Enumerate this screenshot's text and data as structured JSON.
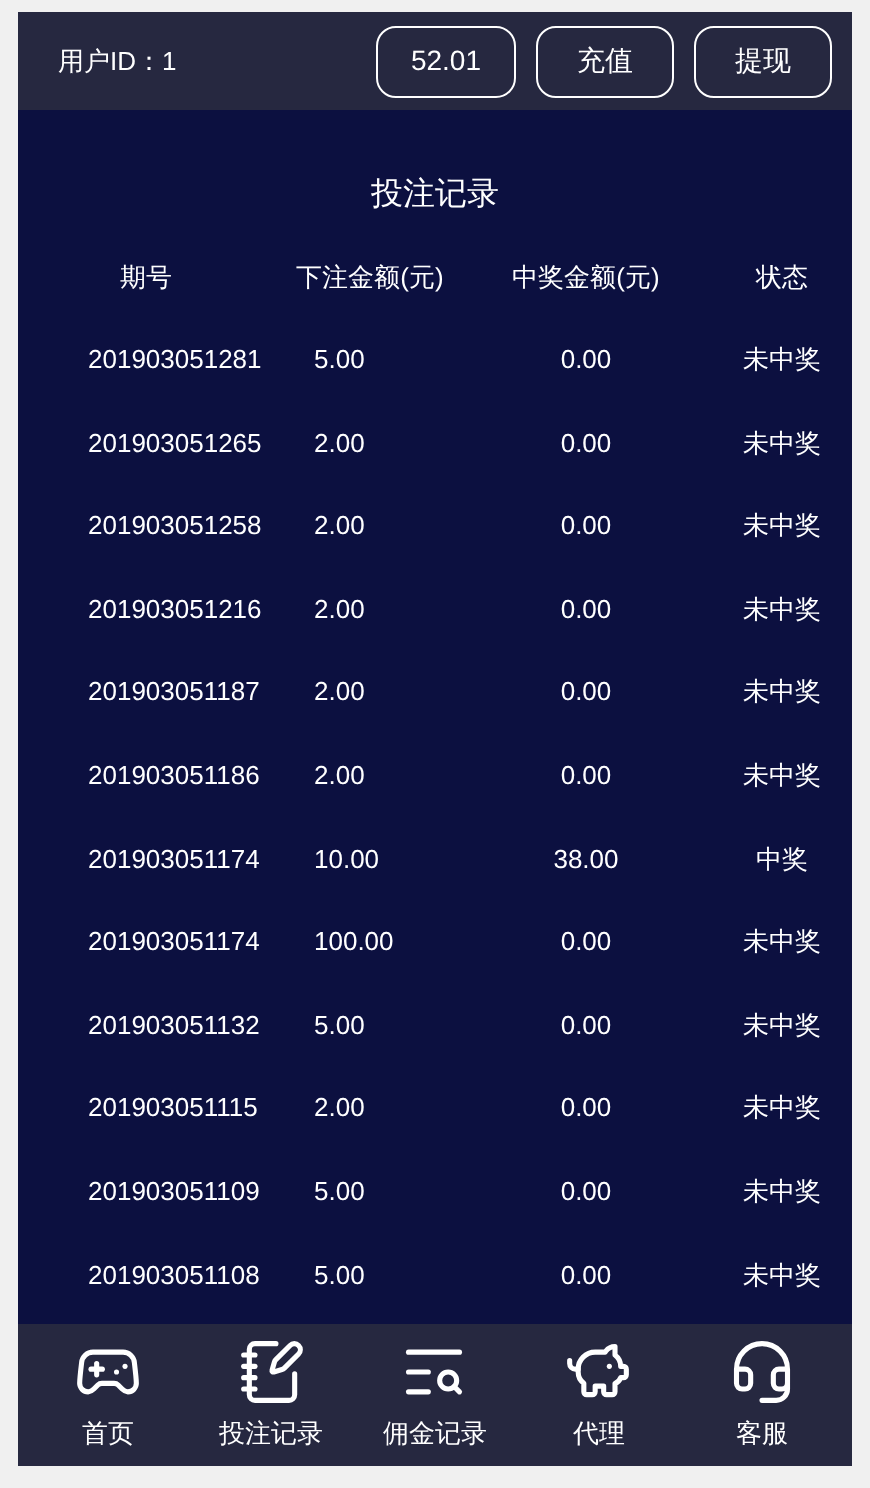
{
  "header": {
    "user_label": "用户ID：1",
    "balance": "52.01",
    "buttons": [
      "充值",
      "提现"
    ]
  },
  "title": "投注记录",
  "table": {
    "columns": [
      "期号",
      "下注金额(元)",
      "中奖金额(元)",
      "状态"
    ],
    "rows": [
      [
        "201903051281",
        "5.00",
        "0.00",
        "未中奖"
      ],
      [
        "201903051265",
        "2.00",
        "0.00",
        "未中奖"
      ],
      [
        "201903051258",
        "2.00",
        "0.00",
        "未中奖"
      ],
      [
        "201903051216",
        "2.00",
        "0.00",
        "未中奖"
      ],
      [
        "201903051187",
        "2.00",
        "0.00",
        "未中奖"
      ],
      [
        "201903051186",
        "2.00",
        "0.00",
        "未中奖"
      ],
      [
        "201903051174",
        "10.00",
        "38.00",
        "中奖"
      ],
      [
        "201903051174",
        "100.00",
        "0.00",
        "未中奖"
      ],
      [
        "201903051132",
        "5.00",
        "0.00",
        "未中奖"
      ],
      [
        "201903051115",
        "2.00",
        "0.00",
        "未中奖"
      ],
      [
        "201903051109",
        "5.00",
        "0.00",
        "未中奖"
      ],
      [
        "201903051108",
        "5.00",
        "0.00",
        "未中奖"
      ]
    ]
  },
  "nav": [
    {
      "label": "首页",
      "kind": "game"
    },
    {
      "label": "投注记录",
      "kind": "bets"
    },
    {
      "label": "佣金记录",
      "kind": "commission"
    },
    {
      "label": "代理",
      "kind": "agent"
    },
    {
      "label": "客服",
      "kind": "service"
    }
  ]
}
